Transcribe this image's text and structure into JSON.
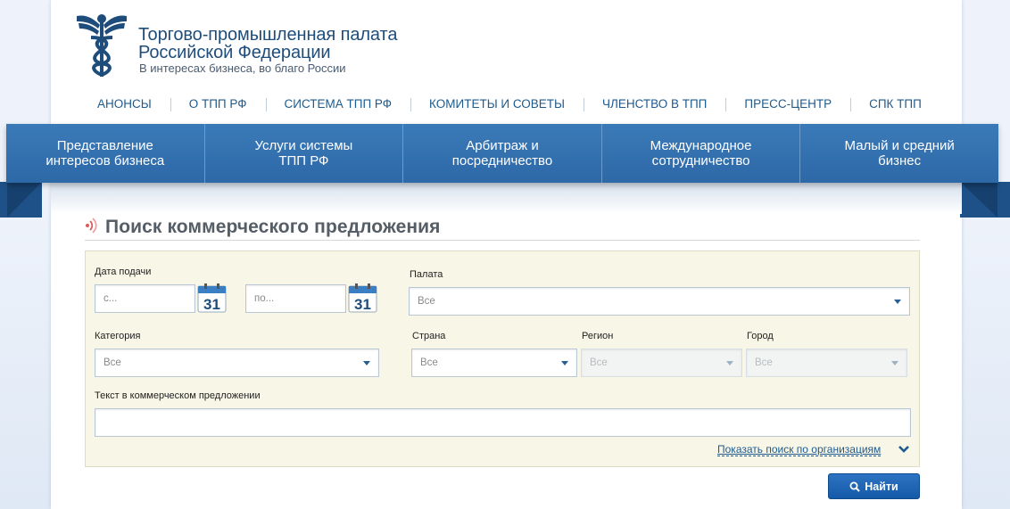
{
  "brand": {
    "title_line1": "Торгово-промышленная палата",
    "title_line2": "Российской Федерации",
    "subtitle": "В интересах бизнеса, во благо России"
  },
  "top_nav": [
    "АНОНСЫ",
    "О ТПП РФ",
    "СИСТЕМА ТПП РФ",
    "КОМИТЕТЫ И СОВЕТЫ",
    "ЧЛЕНСТВО В ТПП",
    "ПРЕСС-ЦЕНТР",
    "СПК ТПП"
  ],
  "main_nav": [
    {
      "line1": "Представление",
      "line2": "интересов бизнеса"
    },
    {
      "line1": "Услуги системы",
      "line2": "ТПП РФ"
    },
    {
      "line1": "Арбитраж и",
      "line2": "посредничество"
    },
    {
      "line1": "Международное",
      "line2": "сотрудничество"
    },
    {
      "line1": "Малый и средний",
      "line2": "бизнес"
    }
  ],
  "section_title": "Поиск коммерческого предложения",
  "filters": {
    "date_label": "Дата подачи",
    "date_from_placeholder": "с...",
    "date_to_placeholder": "по...",
    "calendar_day": "31",
    "chamber_label": "Палата",
    "chamber_value": "Все",
    "category_label": "Категория",
    "category_value": "Все",
    "country_label": "Страна",
    "country_value": "Все",
    "region_label": "Регион",
    "region_value": "Все",
    "city_label": "Город",
    "city_value": "Все",
    "text_label": "Текст в коммерческом предложении",
    "text_value": ""
  },
  "show_org_search": "Показать поиск по организациям",
  "find_button": "Найти",
  "colors": {
    "brand_blue": "#1e4d7c",
    "nav_blue": "#2d68a7",
    "panel_bg": "#f8f7e7",
    "button_blue": "#155aa8",
    "accent_red": "#e05a5a"
  }
}
